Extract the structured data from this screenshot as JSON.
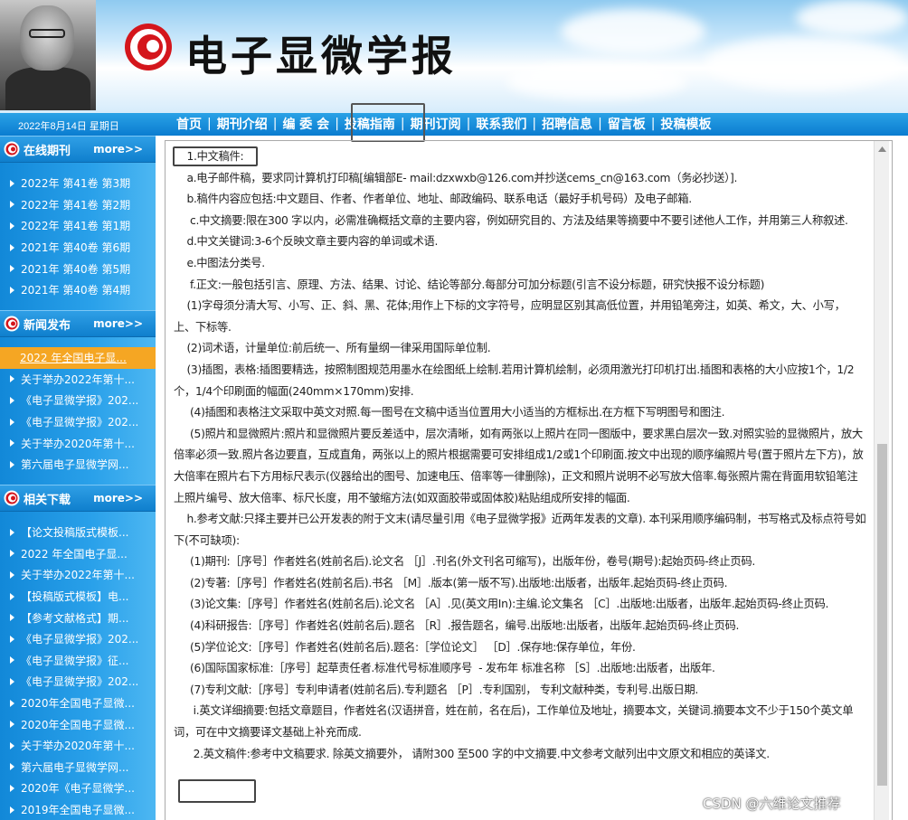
{
  "header": {
    "journal_title": "电子显微学报"
  },
  "nav": {
    "date": "2022年8月14日  星期日",
    "items": [
      "首页",
      "期刊介绍",
      "编 委 会",
      "投稿指南",
      "期刊订阅",
      "联系我们",
      "招聘信息",
      "留言板",
      "投稿模板"
    ],
    "separator": "|",
    "selected": "投稿指南"
  },
  "sidebar": {
    "sections": [
      {
        "title": "在线期刊",
        "more": "more>>",
        "items": [
          "2022年 第41卷 第3期",
          "2022年 第41卷 第2期",
          "2022年 第41卷 第1期",
          "2021年 第40卷 第6期",
          "2021年 第40卷 第5期",
          "2021年 第40卷 第4期"
        ]
      },
      {
        "title": "新闻发布",
        "more": "more>>",
        "items": [
          "2022 年全国电子显...",
          "关于举办2022年第十...",
          "《电子显微学报》202...",
          "《电子显微学报》202...",
          "关于举办2020年第十...",
          "第六届电子显微学网..."
        ]
      },
      {
        "title": "相关下载",
        "more": "more>>",
        "items": [
          "【论文投稿版式模板...",
          "2022 年全国电子显...",
          "关于举办2022年第十...",
          "【投稿版式模板】电...",
          "【参考文献格式】期...",
          "《电子显微学报》202...",
          "《电子显微学报》征...",
          "《电子显微学报》202...",
          "2020年全国电子显微...",
          "2020年全国电子显微...",
          "关于举办2020年第十...",
          "第六届电子显微学网...",
          "2020年《电子显微学...",
          "2019年全国电子显微..."
        ]
      }
    ]
  },
  "content": {
    "paragraphs": [
      "    1.中文稿件:",
      "    a.电子邮件稿，要求同计算机打印稿[编辑部E- mail:dzxwxb@126.com并抄送cems_cn@163.com（务必抄送）].",
      "    b.稿件内容应包括:中文题目、作者、作者单位、地址、邮政编码、联系电话（最好手机号码）及电子邮箱.",
      "     c.中文摘要:限在300 字以内，必需准确概括文章的主要内容，例如研究目的、方法及结果等摘要中不要引述他人工作，并用第三人称叙述.",
      "    d.中文关键词:3-6个反映文章主要内容的单词或术语.",
      "    e.中图法分类号.",
      "     f.正文:一般包括引言、原理、方法、结果、讨论、结论等部分.每部分可加分标题(引言不设分标题，研究快报不设分标题)",
      "    (1)字母须分清大写、小写、正、斜、黑、花体;用作上下标的文字符号，应明显区别其高低位置，并用铅笔旁注，如英、希文，大、小写，  上、下标等.",
      "    (2)词术语，计量单位:前后统一、所有量纲一律采用国际单位制.",
      "    (3)插图，表格:插图要精选，按照制图规范用墨水在绘图纸上绘制.若用计算机绘制，必须用激光打印机打出.插图和表格的大小应按1个，1/2个，1/4个印刷面的幅面(240mm×170mm)安排.",
      "     (4)插图和表格注文采取中英文对照.每一图号在文稿中适当位置用大小适当的方框标出.在方框下写明图号和图注.",
      "     (5)照片和显微照片:照片和显微照片要反差适中，层次清晰，如有两张以上照片在同一图版中，要求黑白层次一致.对照实验的显微照片，放大倍率必须一致.照片各边要直，互成直角，两张以上的照片根据需要可安排组成1/2或1个印刷面.按文中出现的顺序编照片号(置于照片左下方)，放大倍率在照片右下方用标尺表示(仪器给出的图号、加速电压、倍率等一律删除)，正文和照片说明不必写放大倍率.每张照片需在背面用软铅笔注上照片编号、放大倍率、标尺长度，用不皱缩方法(如双面胶带或固体胶)粘贴组成所安排的幅面.",
      "    h.参考文献:只择主要并已公开发表的附于文末(请尽量引用《电子显微学报》近两年发表的文章). 本刊采用顺序编码制，书写格式及标点符号如下(不可缺项):",
      "     (1)期刊:［序号］作者姓名(姓前名后).论文名 ［J］.刊名(外文刊名可缩写)，出版年份，卷号(期号):起始页码-终止页码.",
      "     (2)专著:［序号］作者姓名(姓前名后).书名 ［M］.版本(第一版不写).出版地:出版者，出版年.起始页码-终止页码.",
      "     (3)论文集:［序号］作者姓名(姓前名后).论文名 ［A］.见(英文用In):主编.论文集名 ［C］.出版地:出版者，出版年.起始页码-终止页码.",
      "     (4)科研报告:［序号］作者姓名(姓前名后).题名 ［R］.报告题名，编号.出版地:出版者，出版年.起始页码-终止页码.",
      "     (5)学位论文:［序号］作者姓名(姓前名后).题名:［学位论文］ ［D］.保存地:保存单位，年份.",
      "     (6)国际国家标准:［序号］起草责任者.标准代号标准顺序号  - 发布年 标准名称 ［S］.出版地:出版者，出版年.",
      "     (7)专利文献:［序号］专利申请者(姓前名后).专利题名 ［P］.专利国别， 专利文献种类，专利号.出版日期.",
      "      i.英文详细摘要:包括文章题目，作者姓名(汉语拼音，姓在前，名在后)，工作单位及地址，摘要本文，关键词.摘要本文不少于150个英文单词，可在中文摘要译文基础上补充而成.",
      "      2.英文稿件:参考中文稿要求. 除英文摘要外， 请附300 至500 字的中文摘要.中文参考文献列出中文原文和相应的英译文."
    ]
  },
  "watermark": "CSDN @六维论文推荐",
  "colors": {
    "nav_bg": "#0a7cd0",
    "sidebar_bg": "#2aa1ea",
    "active_item": "#f5a623",
    "logo_red": "#d4161c"
  }
}
